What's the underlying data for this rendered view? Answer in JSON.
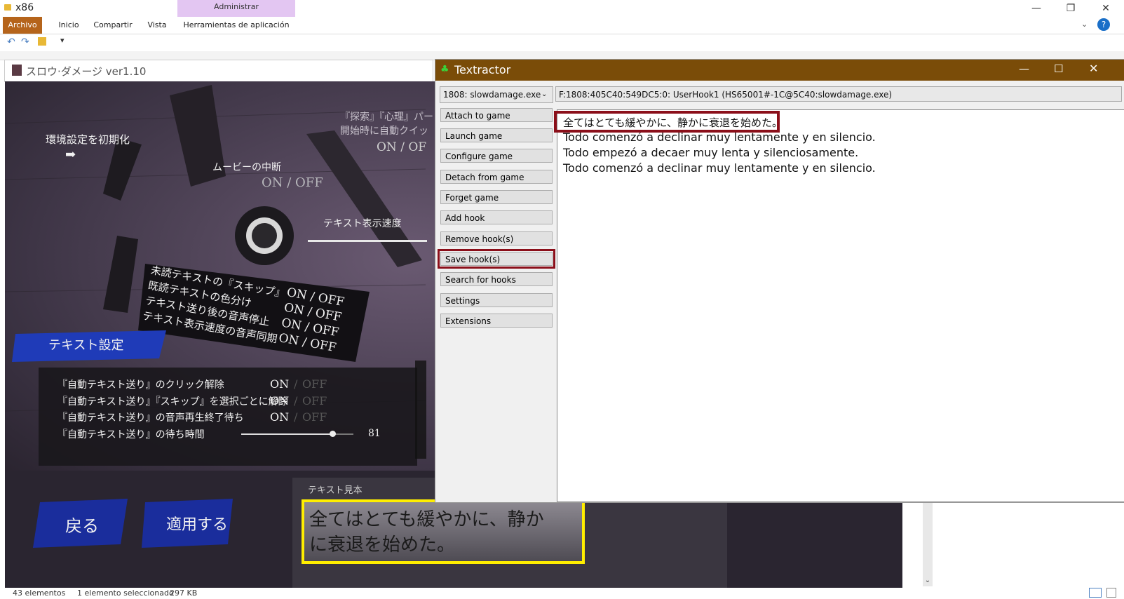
{
  "explorer": {
    "title": "x86",
    "context_tab": "Administrar",
    "ribbon_tabs": [
      "Archivo",
      "Inicio",
      "Compartir",
      "Vista",
      "Herramientas de aplicación"
    ],
    "window_controls": [
      "—",
      "❐",
      "✕"
    ],
    "status": {
      "items": "43 elementos",
      "selected": "1 elemento seleccionado",
      "size": "297 KB"
    }
  },
  "game": {
    "title": "スロウ·ダメージ ver1.10",
    "reset": "環境設定を初期化",
    "top_right_1": "『探索』『心理』パー",
    "top_right_2": "開始時に自動クイッ",
    "top_right_onoff": "ON / OF",
    "movie": "ムービーの中断",
    "movie_onoff": "ON / OFF",
    "speed": "テキスト表示速度",
    "diag": [
      "未読テキストの『スキップ』",
      "既読テキストの色分け",
      "テキスト送り後の音声停止",
      "テキスト表示速度の音声同期"
    ],
    "diag_onoff": [
      "ON / OFF",
      "ON / OFF",
      "ON / OFF",
      "ON / OFF"
    ],
    "section": "テキスト設定",
    "auto_rows": [
      {
        "label": "『自動テキスト送り』のクリック解除",
        "on": "ON",
        "off": "OFF"
      },
      {
        "label": "『自動テキスト送り』『スキップ』を選択ごとに解除",
        "on": "ON",
        "off": "OFF"
      },
      {
        "label": "『自動テキスト送り』の音声再生終了待ち",
        "on": "ON",
        "off": "OFF"
      }
    ],
    "wait_label": "『自動テキスト送り』の待ち時間",
    "wait_value": "81",
    "wait_level": 0.81,
    "back": "戻る",
    "apply": "適用する",
    "sample_label": "テキスト見本",
    "sample_text_1": "全てはとても緩やかに、静か",
    "sample_text_2": "に衰退を始めた。"
  },
  "textractor": {
    "title": "Textractor",
    "process": "1808: slowdamage.exe",
    "hook": "F:1808:405C40:549DC5:0: UserHook1 (HS65001#-1C@5C40:slowdamage.exe)",
    "buttons": [
      "Attach to game",
      "Launch game",
      "Configure game",
      "Detach from game",
      "Forget game",
      "Add hook",
      "Remove hook(s)",
      "Save hook(s)",
      "Search for hooks",
      "Settings",
      "Extensions"
    ],
    "output": [
      "全てはとても緩やかに、静かに衰退を始めた。",
      "Todo comenzó a declinar muy lentamente y en silencio.",
      "Todo empezó a decaer muy lenta y silenciosamente.",
      "Todo comenzó a declinar muy lentamente y en silencio."
    ]
  },
  "colors": {
    "textractor_titlebar": "#7a4c08",
    "highlight_red": "#8b0f1a",
    "highlight_yellow": "#ffee00",
    "archivo_tab": "#b5641b",
    "context_tab": "#e3c6f2"
  }
}
